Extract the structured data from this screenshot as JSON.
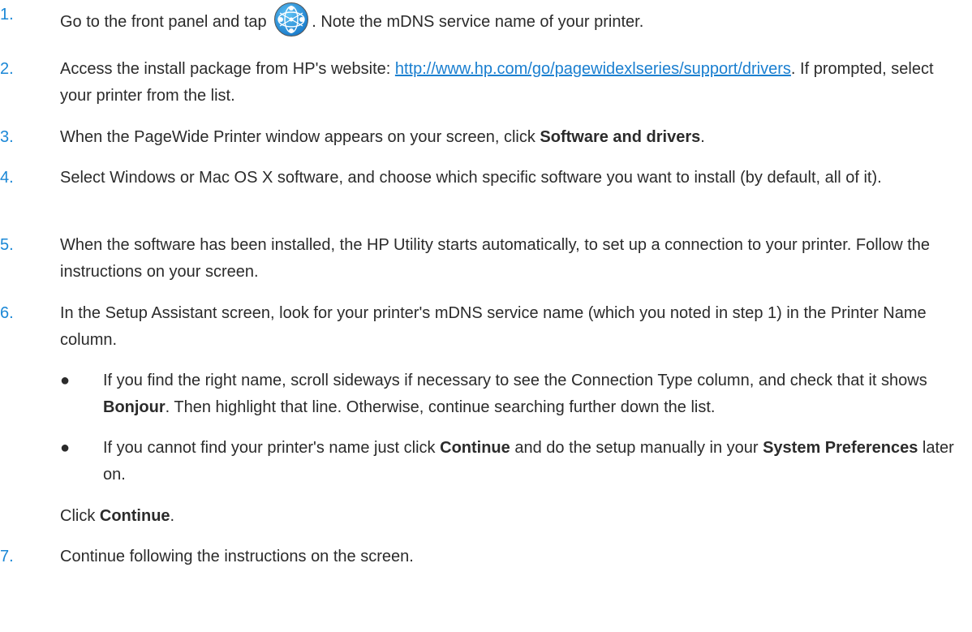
{
  "steps": [
    {
      "num": "1.",
      "pre": "Go to the front panel and tap",
      "icon": "network-globe-icon",
      "post": ". Note the mDNS service name of your printer."
    },
    {
      "num": "2.",
      "pre": "Access the install package from HP's website: ",
      "link": "http://www.hp.com/go/pagewidexlseries/support/drivers",
      "post": ". If prompted, select your printer from the list."
    },
    {
      "num": "3.",
      "pre": "When the PageWide Printer window appears on your screen, click ",
      "bold": "Software and drivers",
      "post": "."
    },
    {
      "num": "4.",
      "text": "Select Windows or Mac OS X software, and choose which specific software you want to install (by default, all of it)."
    },
    {
      "num": "5.",
      "text": "When the software has been installed, the HP Utility starts automatically, to set up a connection to your printer. Follow the instructions on your screen."
    },
    {
      "num": "6.",
      "text": "In the Setup Assistant screen, look for your printer's mDNS service name (which you noted in step 1) in the Printer Name column.",
      "bullets": [
        {
          "dot": "●",
          "pre": "If you find the right name, scroll sideways if necessary to see the Connection Type column, and check that it shows ",
          "bold": "Bonjour",
          "post": ". Then highlight that line. Otherwise, continue searching further down the list."
        },
        {
          "dot": "●",
          "pre": "If you cannot find your printer's name just click ",
          "bold": "Continue",
          "mid": " and do the setup manually in your ",
          "bold2": "System Preferences",
          "post": " later on."
        }
      ],
      "after_pre": "Click ",
      "after_bold": "Continue",
      "after_post": "."
    },
    {
      "num": "7.",
      "text": "Continue following the instructions on the screen."
    }
  ],
  "colors": {
    "step_number": "#1a87d6",
    "link": "#1a7fd0",
    "text": "#2b2b2b"
  }
}
